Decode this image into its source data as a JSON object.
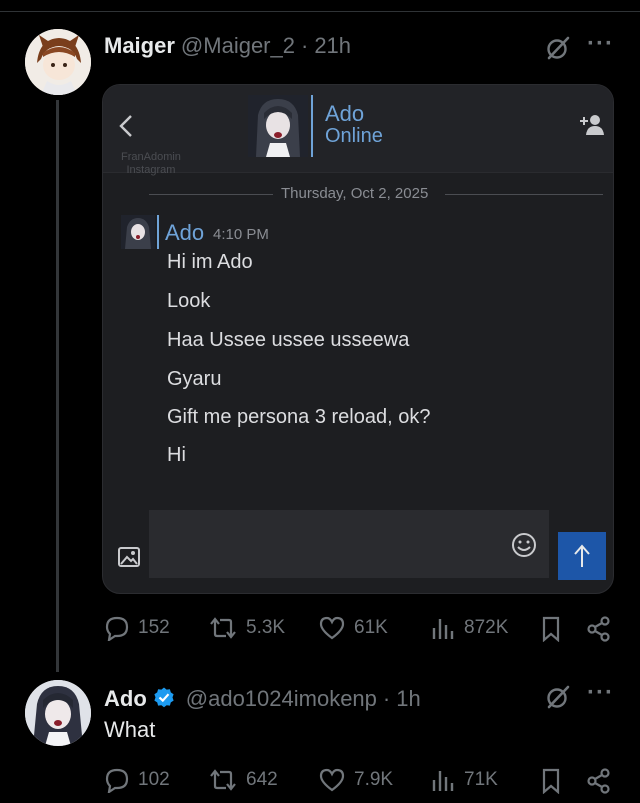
{
  "tweet1": {
    "author_name": "Maiger",
    "author_handle": "@Maiger_2",
    "time_sep": "·",
    "time": "21h",
    "embed": {
      "chat_name": "Ado",
      "chat_status": "Online",
      "watermark": "FranAdomin\nInstagram",
      "date": "Thursday, Oct 2, 2025",
      "sender": "Ado",
      "sent_time": "4:10 PM",
      "messages": [
        "Hi im Ado",
        "Look",
        "Haa Ussee ussee usseewa",
        "Gyaru",
        "Gift me persona 3 reload, ok?",
        "Hi"
      ]
    },
    "stats": {
      "replies": "152",
      "reposts": "5.3K",
      "likes": "61K",
      "views": "872K"
    }
  },
  "tweet2": {
    "author_name": "Ado",
    "author_handle": "@ado1024imokenp",
    "time_sep": "·",
    "time": "1h",
    "text": "What",
    "stats": {
      "replies": "102",
      "reposts": "642",
      "likes": "7.9K",
      "views": "71K"
    }
  },
  "colors": {
    "background": "#000000",
    "text": "#e7e9ea",
    "muted": "#71767b",
    "verified": "#1d9bf0",
    "chat_accent": "#6fa3d8",
    "send_button": "#1d56a8"
  },
  "icons": [
    "grok-icon",
    "more-icon",
    "back-arrow-icon",
    "add-friend-icon",
    "image-icon",
    "emoji-icon",
    "send-arrow-icon",
    "reply-icon",
    "repost-icon",
    "like-icon",
    "views-icon",
    "bookmark-icon",
    "share-icon",
    "verified-badge-icon"
  ]
}
